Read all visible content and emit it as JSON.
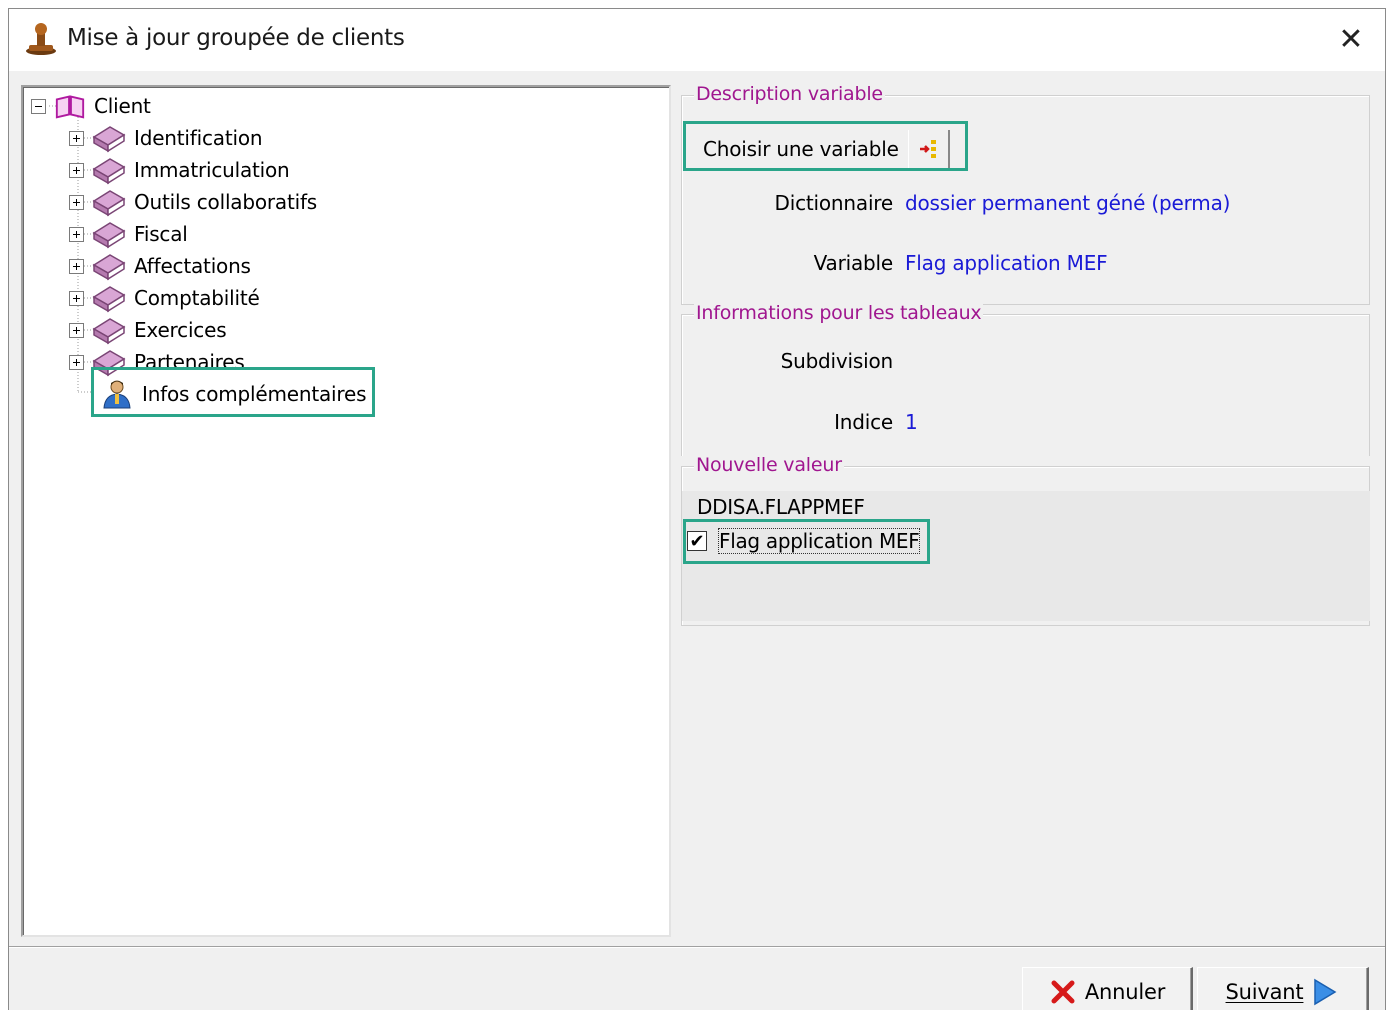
{
  "window": {
    "title": "Mise à jour groupée de clients",
    "close_glyph": "✕"
  },
  "tree": {
    "root": {
      "label": "Client",
      "icon": "open-book-icon"
    },
    "items": [
      {
        "label": "Identification",
        "icon": "closed-book-icon"
      },
      {
        "label": "Immatriculation",
        "icon": "closed-book-icon"
      },
      {
        "label": "Outils collaboratifs",
        "icon": "closed-book-icon"
      },
      {
        "label": "Fiscal",
        "icon": "closed-book-icon"
      },
      {
        "label": "Affectations",
        "icon": "closed-book-icon"
      },
      {
        "label": "Comptabilité",
        "icon": "closed-book-icon"
      },
      {
        "label": "Exercices",
        "icon": "closed-book-icon"
      },
      {
        "label": "Partenaires",
        "icon": "closed-book-icon"
      }
    ],
    "selected": {
      "label": "Infos complémentaires",
      "icon": "person-icon"
    }
  },
  "description": {
    "legend": "Description variable",
    "choose_button": "Choisir une variable",
    "dictionary_label": "Dictionnaire",
    "dictionary_value": "dossier permanent géné (perma)",
    "variable_label": "Variable",
    "variable_value": "Flag application MEF"
  },
  "tables_info": {
    "legend": "Informations pour les tableaux",
    "subdivision_label": "Subdivision",
    "subdivision_value": "",
    "index_label": "Indice",
    "index_value": "1"
  },
  "new_value": {
    "legend": "Nouvelle valeur",
    "field_code": "DDISA.FLAPPMEF",
    "checkbox_label": "Flag application MEF",
    "checked": true,
    "check_glyph": "✔"
  },
  "buttons": {
    "cancel": "Annuler",
    "next": "Suivant"
  },
  "colors": {
    "highlight": "#2aa58a",
    "legend": "#a0168f",
    "value_text": "#1a1ad6"
  }
}
